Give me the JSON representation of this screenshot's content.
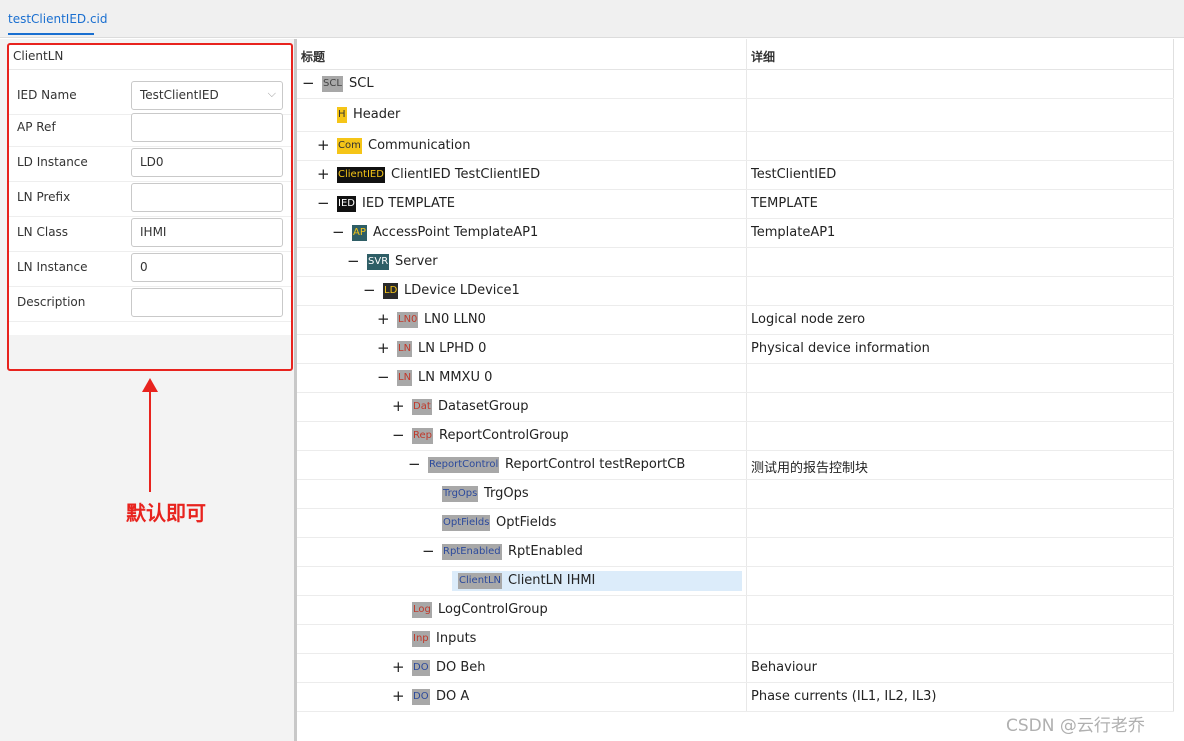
{
  "tab": {
    "label": "testClientIED.cid"
  },
  "form": {
    "title": "ClientLN",
    "fields": [
      {
        "label": "IED Name",
        "value": "TestClientIED",
        "type": "select"
      },
      {
        "label": "AP Ref",
        "value": ""
      },
      {
        "label": "LD Instance",
        "value": "LD0"
      },
      {
        "label": "LN Prefix",
        "value": ""
      },
      {
        "label": "LN Class",
        "value": "IHMI"
      },
      {
        "label": "LN Instance",
        "value": "0"
      },
      {
        "label": "Description",
        "value": ""
      }
    ]
  },
  "annotation": {
    "note": "默认即可",
    "color": "#e8231e"
  },
  "tree": {
    "headers": {
      "title": "标题",
      "detail": "详细"
    },
    "rows": [
      {
        "toggle": "−",
        "badge": "SCL",
        "badge_style": "gray",
        "title": "SCL",
        "detail": "",
        "depth": 0
      },
      {
        "toggle": "",
        "badge": "H",
        "badge_style": "yellow",
        "title": "Header",
        "detail": "",
        "depth": 1
      },
      {
        "toggle": "+",
        "badge": "Com",
        "badge_style": "yellow",
        "title": "Communication",
        "detail": "",
        "depth": 1
      },
      {
        "toggle": "+",
        "badge": "ClientIED",
        "badge_style": "black-yellow",
        "title": "ClientIED TestClientIED",
        "detail": "TestClientIED",
        "depth": 1
      },
      {
        "toggle": "−",
        "badge": "IED",
        "badge_style": "black",
        "title": "IED TEMPLATE",
        "detail": "TEMPLATE",
        "depth": 1
      },
      {
        "toggle": "−",
        "badge": "AP",
        "badge_style": "teal-yellow",
        "title": "AccessPoint TemplateAP1",
        "detail": "TemplateAP1",
        "depth": 2
      },
      {
        "toggle": "−",
        "badge": "SVR",
        "badge_style": "teal",
        "title": "Server",
        "detail": "",
        "depth": 3
      },
      {
        "toggle": "−",
        "badge": "LD",
        "badge_style": "dark-yellow",
        "title": "LDevice LDevice1",
        "detail": "",
        "depth": 4
      },
      {
        "toggle": "+",
        "badge": "LN0",
        "badge_style": "gray-red",
        "title": "LN0 LLN0",
        "detail": "Logical node zero",
        "depth": 5
      },
      {
        "toggle": "+",
        "badge": "LN",
        "badge_style": "gray-red",
        "title": "LN LPHD 0",
        "detail": "Physical device information",
        "depth": 5
      },
      {
        "toggle": "−",
        "badge": "LN",
        "badge_style": "gray-red",
        "title": "LN MMXU 0",
        "detail": "",
        "depth": 5
      },
      {
        "toggle": "+",
        "badge": "Dat",
        "badge_style": "gray-red",
        "title": "DatasetGroup",
        "detail": "",
        "depth": 6
      },
      {
        "toggle": "−",
        "badge": "Rep",
        "badge_style": "gray-red",
        "title": "ReportControlGroup",
        "detail": "",
        "depth": 6
      },
      {
        "toggle": "−",
        "badge": "ReportControl",
        "badge_style": "gray-blue",
        "title": "ReportControl testReportCB",
        "detail": "测试用的报告控制块",
        "depth": 7
      },
      {
        "toggle": "",
        "badge": "TrgOps",
        "badge_style": "gray-blue",
        "title": "TrgOps",
        "detail": "",
        "depth": 8
      },
      {
        "toggle": "",
        "badge": "OptFields",
        "badge_style": "gray-blue",
        "title": "OptFields",
        "detail": "",
        "depth": 8
      },
      {
        "toggle": "−",
        "badge": "RptEnabled",
        "badge_style": "gray-blue",
        "title": "RptEnabled",
        "detail": "",
        "depth": 8
      },
      {
        "toggle": "",
        "badge": "ClientLN",
        "badge_style": "gray-blue",
        "title": "ClientLN IHMI",
        "detail": "",
        "depth": 9,
        "selected": true
      },
      {
        "toggle": "",
        "badge": "Log",
        "badge_style": "gray-red",
        "title": "LogControlGroup",
        "detail": "",
        "depth": 6
      },
      {
        "toggle": "",
        "badge": "Inp",
        "badge_style": "gray-red",
        "title": "Inputs",
        "detail": "",
        "depth": 6
      },
      {
        "toggle": "+",
        "badge": "DO",
        "badge_style": "gray-blue",
        "title": "DO Beh",
        "detail": "Behaviour",
        "depth": 6
      },
      {
        "toggle": "+",
        "badge": "DO",
        "badge_style": "gray-blue",
        "title": "DO A",
        "detail": "Phase currents (IL1, IL2, IL3)",
        "depth": 6
      }
    ]
  },
  "watermark": "CSDN @云行老乔"
}
